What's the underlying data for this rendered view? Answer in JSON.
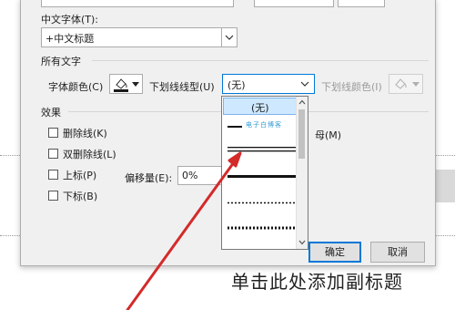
{
  "font": {
    "cn_font_label": "中文字体(T):",
    "cn_font_value": "+中文标题"
  },
  "all_text": {
    "section_label": "所有文字",
    "font_color_label": "字体颜色(C)",
    "underline_style_label": "下划线线型(U)",
    "underline_style_value": "(无)",
    "underline_color_label": "下划线颜色(I)"
  },
  "effects": {
    "section_label": "效果",
    "strikethrough": "删除线(K)",
    "double_strikethrough": "双删除线(L)",
    "superscript": "上标(P)",
    "subscript": "下标(B)",
    "offset_label": "偏移量(E):",
    "offset_value": "0%",
    "right_option_partial": "母(M)"
  },
  "dropdown": {
    "items": [
      {
        "label": "(无)",
        "type": "none",
        "selected": true
      },
      {
        "label": "电子白博客",
        "type": "words"
      },
      {
        "label": "",
        "type": "double"
      },
      {
        "label": "",
        "type": "thick"
      },
      {
        "label": "",
        "type": "dotted"
      },
      {
        "label": "",
        "type": "heavy-dotted"
      }
    ]
  },
  "buttons": {
    "ok": "确定",
    "cancel": "取消"
  },
  "slide": {
    "subtitle_placeholder": "单击此处添加副标题"
  },
  "colors": {
    "accent": "#0078d7",
    "arrow": "#d42a2a",
    "dialog_bg": "#f0f0f0",
    "selected_item": "#cde8ff"
  }
}
